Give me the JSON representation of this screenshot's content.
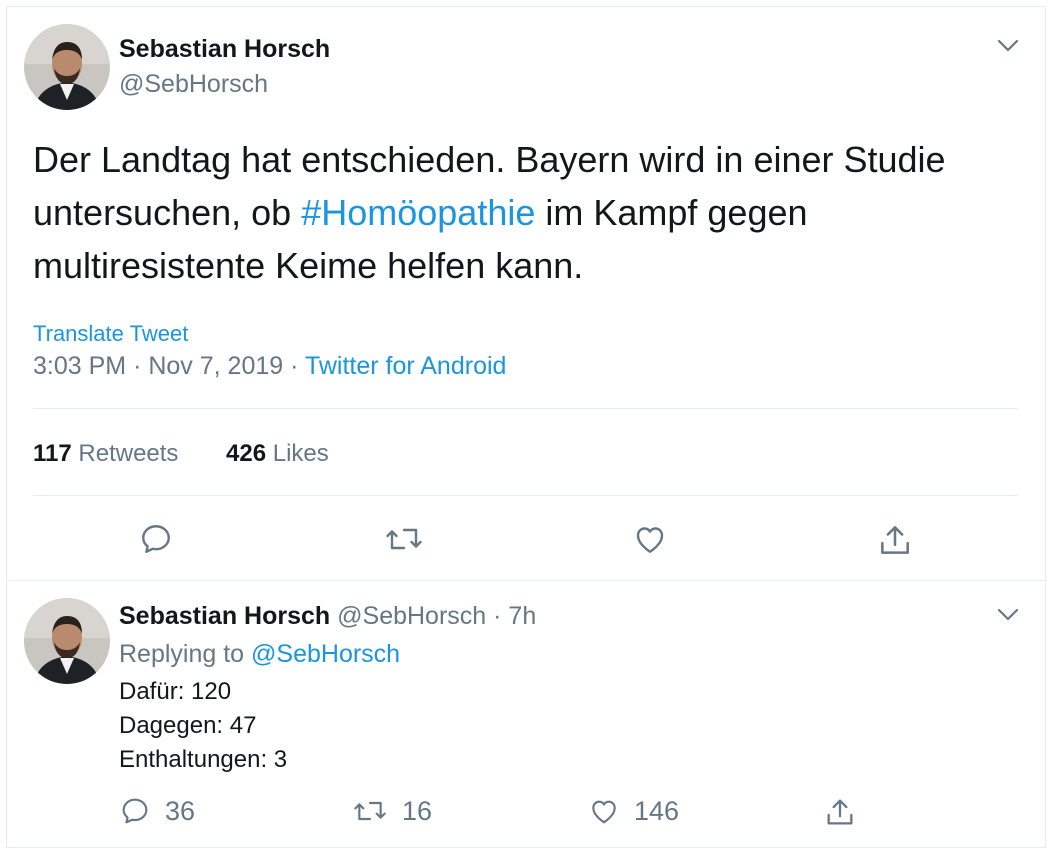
{
  "main_tweet": {
    "author_name": "Sebastian Horsch",
    "author_handle": "@SebHorsch",
    "text_before": "Der Landtag hat entschieden. Bayern wird in einer Studie untersuchen, ob ",
    "hashtag": "#Homöopathie",
    "text_after": " im Kampf gegen multiresistente Keime helfen kann.",
    "translate_label": "Translate Tweet",
    "time": "3:03 PM",
    "date": "Nov 7, 2019",
    "separator": "·",
    "source": "Twitter for Android",
    "retweets_count": "117",
    "retweets_label": "Retweets",
    "likes_count": "426",
    "likes_label": "Likes"
  },
  "reply_tweet": {
    "author_name": "Sebastian Horsch",
    "author_handle": "@SebHorsch",
    "age": "· 7h",
    "replying_prefix": "Replying to",
    "replying_handle": "@SebHorsch",
    "lines": [
      "Dafür: 120",
      "Dagegen: 47",
      "Enthaltungen: 3"
    ],
    "reply_count": "36",
    "retweet_count": "16",
    "like_count": "146"
  },
  "icons": [
    "reply-icon",
    "retweet-icon",
    "like-icon",
    "share-icon",
    "chevron-down-icon"
  ],
  "colors": {
    "link": "#1b95e0",
    "muted": "#657786",
    "text": "#14171a",
    "border": "#e6ecf0"
  }
}
